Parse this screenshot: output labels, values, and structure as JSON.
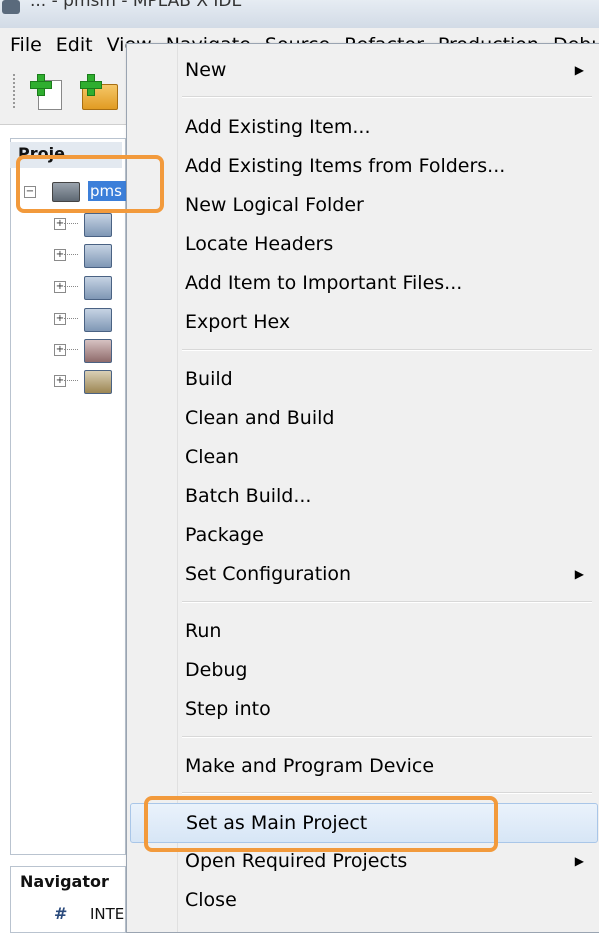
{
  "window": {
    "title_partial": "... - pmsm - MPLAB X IDE"
  },
  "menubar": {
    "items": [
      "File",
      "Edit",
      "View",
      "Navigate",
      "Source",
      "Refactor",
      "Production",
      "Debug"
    ]
  },
  "projects_panel": {
    "tab_label": "Proje...",
    "project_label": "pms"
  },
  "navigator": {
    "title": "Navigator",
    "item_label": "INTE",
    "item_icon_glyph": "#"
  },
  "context_menu": {
    "items": [
      {
        "label": "New",
        "has_submenu": true
      },
      {
        "label": "Add Existing Item...",
        "has_submenu": false
      },
      {
        "label": "Add Existing Items from Folders...",
        "has_submenu": false
      },
      {
        "label": "New Logical Folder",
        "has_submenu": false
      },
      {
        "label": "Locate Headers",
        "has_submenu": false
      },
      {
        "label": "Add Item to Important Files...",
        "has_submenu": false
      },
      {
        "label": "Export Hex",
        "has_submenu": false
      },
      {
        "label": "Build",
        "has_submenu": false
      },
      {
        "label": "Clean and Build",
        "has_submenu": false
      },
      {
        "label": "Clean",
        "has_submenu": false
      },
      {
        "label": "Batch Build...",
        "has_submenu": false
      },
      {
        "label": "Package",
        "has_submenu": false
      },
      {
        "label": "Set Configuration",
        "has_submenu": true
      },
      {
        "label": "Run",
        "has_submenu": false
      },
      {
        "label": "Debug",
        "has_submenu": false
      },
      {
        "label": "Step into",
        "has_submenu": false
      },
      {
        "label": "Make and Program Device",
        "has_submenu": false
      },
      {
        "label": "Set as Main Project",
        "has_submenu": false,
        "highlighted": true
      },
      {
        "label": "Open Required Projects",
        "has_submenu": true
      },
      {
        "label": "Close",
        "has_submenu": false
      }
    ],
    "submenu_arrow_glyph": "▶"
  },
  "colors": {
    "highlight_orange": "#f29a3c",
    "selection_blue": "#3c7fd9"
  }
}
